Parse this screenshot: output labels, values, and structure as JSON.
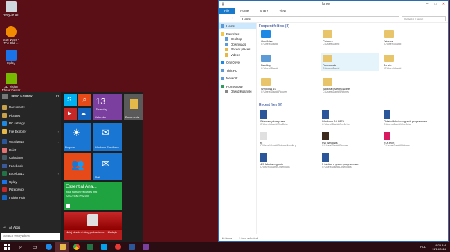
{
  "desktop": {
    "icons": [
      {
        "label": "Recycle Bin",
        "color": "#cfd8dc"
      },
      {
        "label": "Star Wars - The Old ...",
        "color": "#f28b00"
      },
      {
        "label": "Uplay",
        "color": "#1a73e8"
      },
      {
        "label": "3D Vision Photo Viewer",
        "color": "#76b900"
      }
    ]
  },
  "start_menu": {
    "user": "Dawid Kosinski",
    "power_icon": "power-icon",
    "items": [
      {
        "label": "Documents",
        "color": "#c9a14a"
      },
      {
        "label": "Pictures",
        "color": "#c9a14a"
      },
      {
        "label": "PC settings",
        "color": "#1e88e5"
      },
      {
        "label": "File Explorer",
        "color": "#e5b84a"
      },
      {
        "label": "Word 2013",
        "color": "#2b579a"
      },
      {
        "label": "Paint",
        "color": "#e57373"
      },
      {
        "label": "Calculator",
        "color": "#455a64"
      },
      {
        "label": "Facebook",
        "color": "#3b5998"
      },
      {
        "label": "Excel 2013",
        "color": "#217346"
      },
      {
        "label": "Uplay",
        "color": "#1a73e8"
      },
      {
        "label": "Przepisy.pl",
        "color": "#c62828"
      },
      {
        "label": "Insider Hub",
        "color": "#1565c0"
      }
    ],
    "all_apps": "All Apps",
    "search_placeholder": "Search everywhere",
    "tiles": {
      "calendar_number": "13",
      "calendar_day": "Thursday",
      "calendar_label": "Calendar",
      "documents_label": "Documents",
      "weather_label": "Pogoda",
      "reader_label": "Windows Feedback",
      "people_label": "",
      "mail_label": "Mail",
      "office_title": "Essential Ana...",
      "office_sub": "Your human resources info",
      "office_time": "22:00 (GMT+02:00)",
      "news_label": "Mniej strachu i obcy podziałów w ... Madrytu"
    }
  },
  "explorer": {
    "title": "Home",
    "tabs": [
      "File",
      "Home",
      "Share",
      "View"
    ],
    "path": "Home",
    "search_placeholder": "Search Home",
    "nav": {
      "quick_access": "Favorites",
      "items": [
        "Desktop",
        "Downloads",
        "Recent places",
        "Videos"
      ],
      "onedrive": "OneDrive",
      "thispc": "This PC",
      "network": "Network",
      "homegroup": "Homegroup",
      "homegroup_user": "Dawid Kosinski"
    },
    "frequent_header": "Frequent folders (8)",
    "frequent": [
      {
        "name": "OneDrive",
        "sub": "C:\\Users\\Dawid"
      },
      {
        "name": "Pictures",
        "sub": "C:\\Users\\Dawid"
      },
      {
        "name": "Videos",
        "sub": "C:\\Users\\Dawid"
      },
      {
        "name": "Desktop",
        "sub": "C:\\Users\\Dawid"
      },
      {
        "name": "Documents",
        "sub": "C:\\Users\\Dawid"
      },
      {
        "name": "Music",
        "sub": "C:\\Users\\Dawid"
      },
      {
        "name": "Windows 10",
        "sub": "C:\\Users\\Dawid\\Pictures"
      },
      {
        "name": "Wlókna przepisowdne",
        "sub": "C:\\Users\\Dawid\\Pictures"
      }
    ],
    "recent_header": "Recent files (8)",
    "recent": [
      {
        "name": "Składamy komputer",
        "sub": "C:\\Users\\Dawid\\OneDrive",
        "color": "#2b579a"
      },
      {
        "name": "Windows 10 9879",
        "sub": "C:\\Users\\Dawid\\OneDrive",
        "color": "#2b579a"
      },
      {
        "name": "Ostatni faktów o grach programowe",
        "sub": "C:\\Users\\Dawid\\OneDrive",
        "color": "#2b579a"
      },
      {
        "name": "fit",
        "sub": "C:\\Users\\Dawid\\Pictures\\Mobile p...",
        "color": "#e0e0e0"
      },
      {
        "name": "nyc windows",
        "sub": "C:\\Users\\Dawid\\Pictures",
        "color": "#3d2b1f"
      },
      {
        "name": "ZOLtech",
        "sub": "C:\\Users\\Dawid\\Pictures",
        "color": "#d81b60"
      },
      {
        "name": "4.5 faktów o grach",
        "sub": "C:\\Users\\Dawid\\Downloads",
        "color": "#2b579a"
      },
      {
        "name": "5 faktów o grach programowe",
        "sub": "C:\\Users\\Dawid\\Downloads",
        "color": "#2b579a"
      }
    ],
    "status_items": "16 items",
    "status_selected": "1 item selected"
  },
  "taskbar": {
    "apps": [
      {
        "name": "search-app",
        "color": "#ffffff"
      },
      {
        "name": "task-view-app",
        "color": "#ffffff"
      },
      {
        "name": "internet-explorer-app",
        "color": "#1e88e5"
      },
      {
        "name": "file-explorer-app",
        "color": "#e5b84a"
      },
      {
        "name": "chrome-app",
        "color": "#fbbc05"
      },
      {
        "name": "excel-app",
        "color": "#217346"
      },
      {
        "name": "store-app",
        "color": "#00a2ed"
      },
      {
        "name": "opera-app",
        "color": "#e53935"
      },
      {
        "name": "word-app",
        "color": "#2b579a"
      },
      {
        "name": "onenote-app",
        "color": "#7b3fa0"
      }
    ],
    "lang": "POL",
    "time": "8:25 AM",
    "date": "11/13/2014"
  }
}
